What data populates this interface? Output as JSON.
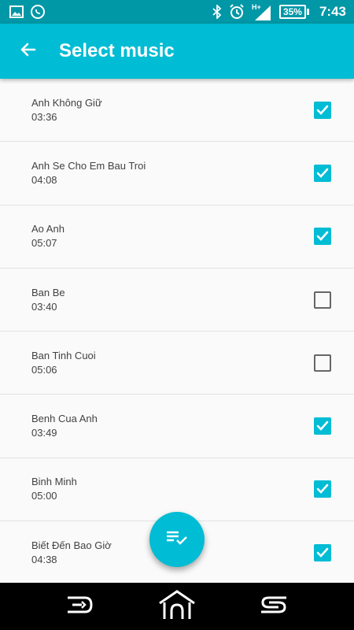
{
  "status_bar": {
    "time": "7:43",
    "battery": "35%",
    "network": "H+",
    "icons": [
      "image-icon",
      "whatsapp-icon",
      "bluetooth-icon",
      "alarm-icon",
      "signal-icon",
      "battery-icon"
    ]
  },
  "app_bar": {
    "title": "Select music",
    "back_icon": "arrow-back-icon"
  },
  "colors": {
    "primary": "#00bcd4",
    "primary_dark": "#0097a7",
    "text": "#424242",
    "unchecked": "#666666"
  },
  "songs": [
    {
      "title": "Anh Không Giữ",
      "duration": "03:36",
      "checked": true
    },
    {
      "title": "Anh Se Cho Em Bau Troi",
      "duration": "04:08",
      "checked": true
    },
    {
      "title": "Ao Anh",
      "duration": "05:07",
      "checked": true
    },
    {
      "title": "Ban Be",
      "duration": "03:40",
      "checked": false
    },
    {
      "title": "Ban Tinh Cuoi",
      "duration": "05:06",
      "checked": false
    },
    {
      "title": "Benh Cua Anh",
      "duration": "03:49",
      "checked": true
    },
    {
      "title": "Binh Minh",
      "duration": "05:00",
      "checked": true
    },
    {
      "title": "Biết Đến Bao Giờ",
      "duration": "04:38",
      "checked": true
    }
  ],
  "fab": {
    "icon": "playlist-check-icon"
  },
  "nav_bar": {
    "icons": [
      "back-nav-icon",
      "home-nav-icon",
      "recent-apps-icon"
    ]
  }
}
